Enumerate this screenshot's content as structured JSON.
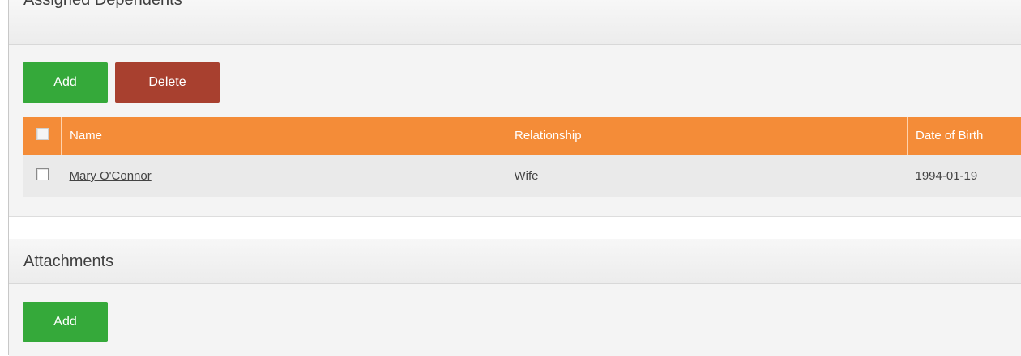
{
  "assigned_dependents": {
    "title": "Assigned Dependents",
    "add_label": "Add",
    "delete_label": "Delete",
    "columns": [
      "Name",
      "Relationship",
      "Date of Birth"
    ],
    "rows": [
      {
        "name": "Mary O'Connor",
        "relationship": "Wife",
        "date_of_birth": "1994-01-19"
      }
    ]
  },
  "attachments": {
    "title": "Attachments",
    "add_label": "Add"
  },
  "colors": {
    "add_button": "#35a93a",
    "delete_button": "#a8402f",
    "table_header": "#f48c38",
    "row_background": "#eaeaea"
  }
}
